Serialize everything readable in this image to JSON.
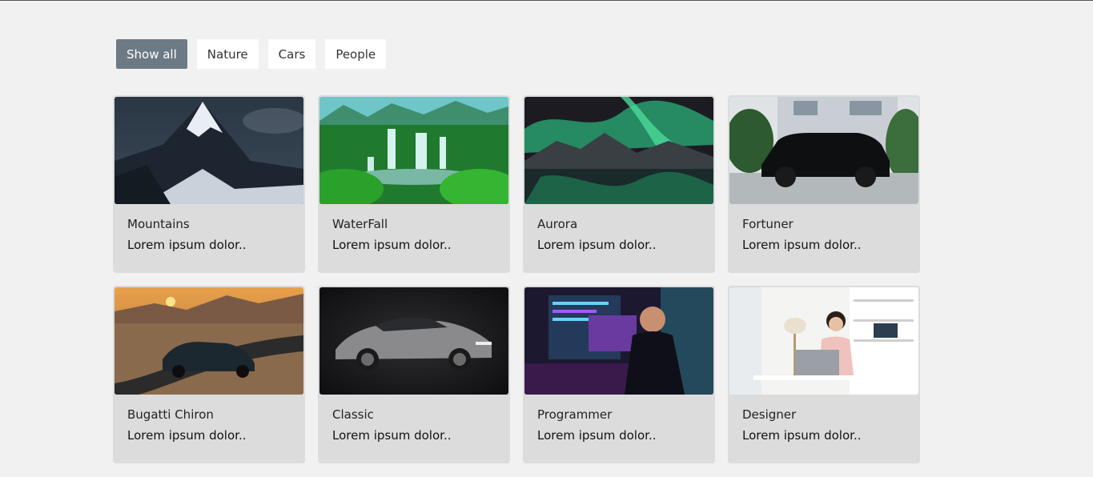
{
  "filters": [
    {
      "label": "Show all",
      "active": true
    },
    {
      "label": "Nature",
      "active": false
    },
    {
      "label": "Cars",
      "active": false
    },
    {
      "label": "People",
      "active": false
    }
  ],
  "cards": [
    {
      "title": "Mountains",
      "desc": "Lorem ipsum dolor..",
      "image": "snowy-mountain-peak"
    },
    {
      "title": "WaterFall",
      "desc": "Lorem ipsum dolor..",
      "image": "jungle-waterfalls"
    },
    {
      "title": "Aurora",
      "desc": "Lorem ipsum dolor..",
      "image": "aurora-over-lake"
    },
    {
      "title": "Fortuner",
      "desc": "Lorem ipsum dolor..",
      "image": "black-suv"
    },
    {
      "title": "Bugatti Chiron",
      "desc": "Lorem ipsum dolor..",
      "image": "sports-car-sunset-road"
    },
    {
      "title": "Classic",
      "desc": "Lorem ipsum dolor..",
      "image": "silver-coupe-dark"
    },
    {
      "title": "Programmer",
      "desc": "Lorem ipsum dolor..",
      "image": "programmer-at-monitors"
    },
    {
      "title": "Designer",
      "desc": "Lorem ipsum dolor..",
      "image": "woman-at-laptop"
    }
  ],
  "colors": {
    "active_filter": "#6c7a86",
    "card_bg": "#dcdcdc",
    "page_bg": "#f1f1f1"
  }
}
